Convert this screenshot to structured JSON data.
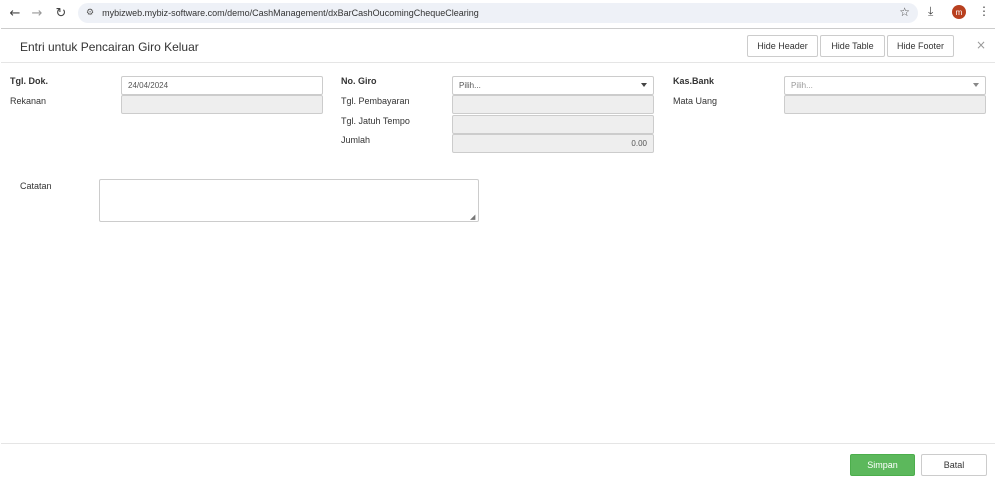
{
  "browser": {
    "url": "mybizweb.mybiz-software.com/demo/CashManagement/dxBarCashOucomingChequeClearing",
    "avatar_letter": "m",
    "icons": [
      "back-icon",
      "forward-icon",
      "reload-icon",
      "site-settings-icon",
      "star-icon",
      "download-icon",
      "kebab-menu-icon"
    ]
  },
  "modal": {
    "title": "Entri untuk Pencairan Giro Keluar",
    "buttons": {
      "hide_header": "Hide Header",
      "hide_table": "Hide Table",
      "hide_footer": "Hide Footer"
    },
    "close": "×"
  },
  "form": {
    "tgl_dok_label": "Tgl. Dok.",
    "tgl_dok_value": "24/04/2024",
    "rekanan_label": "Rekanan",
    "rekanan_value": "",
    "no_giro_label": "No. Giro",
    "no_giro_placeholder": "Pilih...",
    "tgl_pembayaran_label": "Tgl. Pembayaran",
    "tgl_jatuh_tempo_label": "Tgl. Jatuh Tempo",
    "jumlah_label": "Jumlah",
    "jumlah_value": "0.00",
    "kas_bank_label": "Kas.Bank",
    "kas_bank_placeholder": "Pilih...",
    "mata_uang_label": "Mata Uang",
    "mata_uang_value": "",
    "catatan_label": "Catatan",
    "catatan_value": ""
  },
  "footer": {
    "save": "Simpan",
    "cancel": "Batal"
  },
  "colors": {
    "save_button": "#5cb85c",
    "avatar": "#b8401f"
  }
}
